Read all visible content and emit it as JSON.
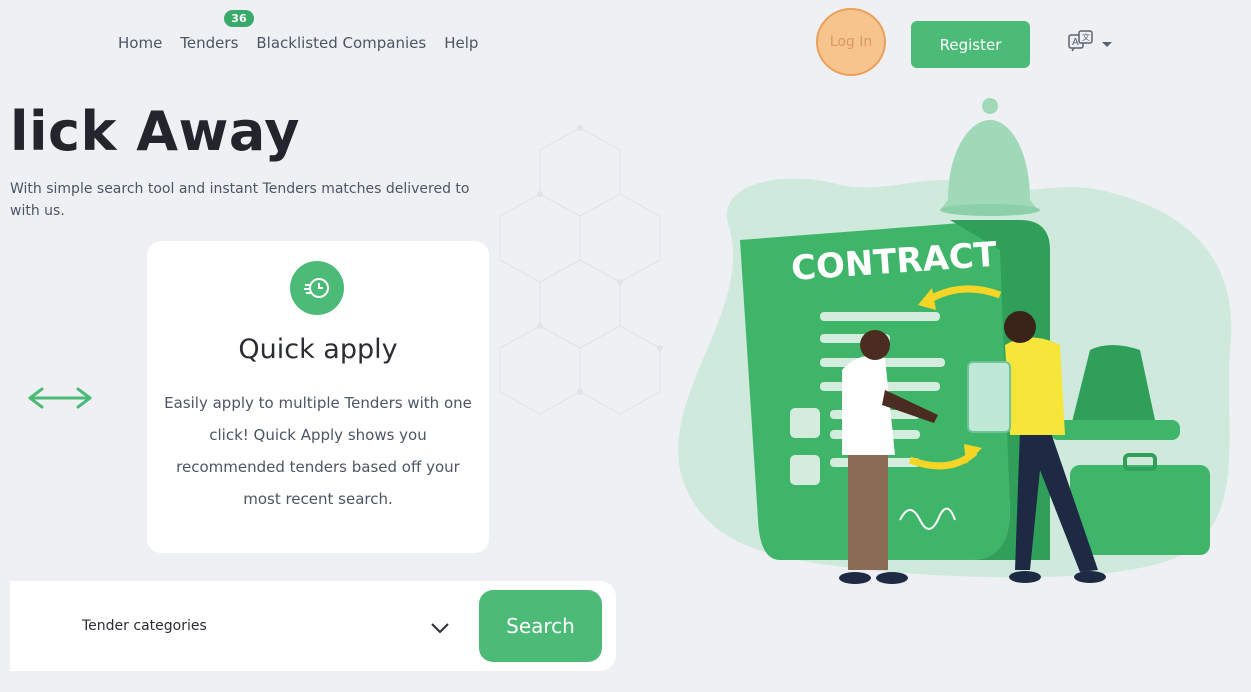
{
  "nav": {
    "links": [
      {
        "label": "Home"
      },
      {
        "label": "Tenders",
        "badge": "36"
      },
      {
        "label": "Blacklisted Companies"
      },
      {
        "label": "Help"
      }
    ],
    "login_label": "Log In",
    "register_label": "Register",
    "language_icon": "translate-icon"
  },
  "hero": {
    "title": "lick Away",
    "subtitle": "With simple search tool and instant Tenders matches delivered to with us."
  },
  "card": {
    "icon": "clock-fast-icon",
    "title": "Quick apply",
    "description": "Easily apply to multiple Tenders with one click! Quick Apply shows you recommended tenders based off your most recent search."
  },
  "search": {
    "category_label": "Tender categories",
    "button_label": "Search"
  },
  "illustration": {
    "contract_text": "CONTRACT"
  },
  "colors": {
    "accent": "#4cbb78",
    "background": "#eef0f4",
    "login_highlight": "#f7c48d"
  }
}
